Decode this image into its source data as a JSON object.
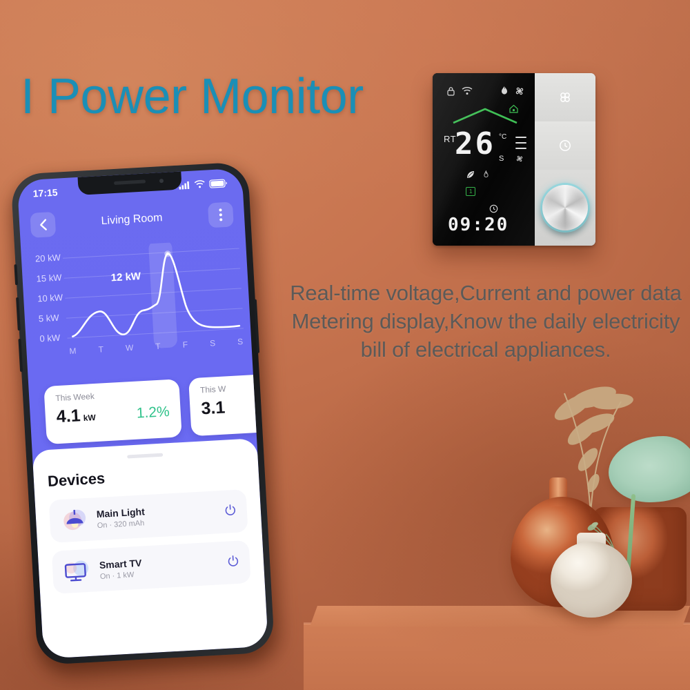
{
  "headline": "I Power Monitor",
  "marketing_copy": "Real-time voltage,Current and power data Metering display,Know the daily electricity bill of electrical appliances.",
  "colors": {
    "wall": "#c87550",
    "headline_teal": "#1b8fb6",
    "app_purple": "#6b6bf0",
    "accent_green": "#2fc28a",
    "lcd_green": "#35b44a"
  },
  "phone": {
    "status_bar": {
      "time": "17:15",
      "signal_icon": "cellular-signal-icon",
      "wifi_icon": "wifi-icon",
      "battery_icon": "battery-icon"
    },
    "app_bar": {
      "back_icon": "chevron-left-icon",
      "title": "Living Room",
      "menu_icon": "more-vertical-icon"
    },
    "cards": [
      {
        "label": "This Week",
        "value": "4.1",
        "unit": "kW",
        "delta": "1.2%"
      },
      {
        "label": "This W",
        "value": "3.1",
        "unit": "",
        "delta": ""
      }
    ],
    "devices_section": {
      "title": "Devices",
      "items": [
        {
          "name": "Main Light",
          "status": "On",
          "detail": "320 mAh",
          "separator": "·",
          "icon": "ceiling-lamp-icon",
          "toggle_icon": "power-icon"
        },
        {
          "name": "Smart TV",
          "status": "On",
          "detail": "1 kW",
          "separator": "·",
          "icon": "television-icon",
          "toggle_icon": "power-icon"
        }
      ]
    }
  },
  "chart_data": {
    "type": "line",
    "title": "",
    "xlabel": "",
    "ylabel": "",
    "categories": [
      "M",
      "T",
      "W",
      "T",
      "F",
      "S",
      "S"
    ],
    "y_ticks": [
      "20 kW",
      "15 kW",
      "10 kW",
      "5 kW",
      "0 kW"
    ],
    "ylim": [
      0,
      20
    ],
    "values": [
      0.8,
      8.0,
      0.6,
      9.5,
      20.0,
      4.0,
      2.8
    ],
    "annotation": "12 kW",
    "highlight_category": "F",
    "marker_point": {
      "x": "F",
      "y": 20
    },
    "grid": true,
    "legend": "none"
  },
  "thermostat": {
    "lcd": {
      "status_icons": [
        "lock-icon",
        "wifi-icon",
        "flame-icon",
        "fan-icon"
      ],
      "room_temp_label": "RT",
      "temperature": "26",
      "temp_unit": "°C",
      "set_unit": "S",
      "clock": "09:20",
      "battery_badge": "1",
      "roof_graphic": "roof-chevron-icon",
      "house_icon": "house-icon",
      "leaf_icon": "leaf-icon",
      "small_flame_icon": "flame-icon",
      "clock_icon": "clock-icon",
      "signal_bars_icon": "signal-bars-icon",
      "fan_small_icon": "fan-icon"
    },
    "buttons": [
      {
        "icon": "apps-grid-icon",
        "name": "scene-button"
      },
      {
        "icon": "timer-clock-icon",
        "name": "timer-button"
      }
    ],
    "knob": {
      "icon": "rotary-knob",
      "name": "rotary-dial"
    }
  },
  "decor": {
    "pampas_vase": "amber-glass-vase",
    "white_vase": "white-ceramic-vase",
    "leaf": "monstera-leaf",
    "shelf": "orange-shelf"
  }
}
